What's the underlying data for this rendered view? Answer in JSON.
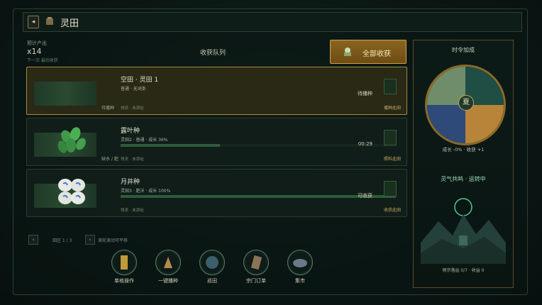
{
  "header": {
    "title": "灵田",
    "back_icon": "arrow-left-icon",
    "field_icon": "field-icon"
  },
  "summary": {
    "est_label": "预计产出",
    "est_value": "x14",
    "est_sub": "下一次 最后收获"
  },
  "queue": {
    "title": "收获队列",
    "harvest_all": "全部收获"
  },
  "cards": [
    {
      "name": "空田 · 灵田 1",
      "meta": "普通 · 无词条",
      "foot": "领灵 · 未添祉",
      "left_state": "待播种",
      "status": "待播种",
      "action": "播种此田",
      "progress": 0
    },
    {
      "name": "露叶种",
      "meta": "灵田2 · 普通 · 成长 36%",
      "foot": "领灵 · 未添祉",
      "left_state": "缺水 / 肥",
      "status": "00:29",
      "action": "照料此田",
      "progress": 0.36
    },
    {
      "name": "月井种",
      "meta": "灵田3 · 肥沃 · 成长 100%",
      "foot": "领灵 · 未添祉",
      "left_state": "",
      "status": "可收获",
      "action": "收获此田",
      "progress": 1.0
    }
  ],
  "pager": {
    "prev": "‹",
    "label": "田区 1 / 3",
    "next": "›",
    "hint": "滚轮滚动可平移"
  },
  "bottom": [
    {
      "label": "单格操作",
      "icon": "scroll-icon"
    },
    {
      "label": "一键播种",
      "icon": "seed-bag-icon"
    },
    {
      "label": "巡田",
      "icon": "patrol-icon"
    },
    {
      "label": "宗门订单",
      "icon": "order-icon"
    },
    {
      "label": "集市",
      "icon": "market-icon"
    }
  ],
  "side": {
    "title": "时令加成",
    "season": "夏",
    "stats": "成长 -0%  ·  收获 +1",
    "spirit": "灵气共鸣 · 运转中",
    "foot": "侧宗落益 0/7  ·  收益 0"
  }
}
